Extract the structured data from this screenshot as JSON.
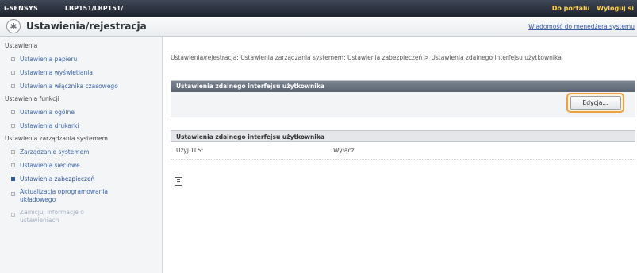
{
  "topbar": {
    "brand": "i-SENSYS",
    "model": "LBP151/LBP151/",
    "portal_link": "Do portalu",
    "logout_link": "Wyloguj si"
  },
  "header": {
    "title": "Ustawienia/rejestracja",
    "admin_message": "Wiadomość do menedżera systemu"
  },
  "sidebar": {
    "group_1": "Ustawienia",
    "paper": "Ustawienia papieru",
    "display": "Ustawienia wyświetlania",
    "timer": "Ustawienia włącznika czasowego",
    "group_2": "Ustawienia funkcji",
    "general": "Ustawienia ogólne",
    "printer": "Ustawienia drukarki",
    "group_3": "Ustawienia zarządzania systemem",
    "system_mgmt": "Zarządzanie systemem",
    "network": "Ustawienia sieciowe",
    "security": "Ustawienia zabezpieczeń",
    "firmware_line1": "Aktualizacja oprogramowania",
    "firmware_line2": "układowego",
    "clear_line1": "Zainicjuj informacje o",
    "clear_line2": "ustawieniach"
  },
  "main": {
    "breadcrumb": "Ustawienia/rejestracja: Ustawienia zarządzania systemem: Ustawienia zabezpieczeń > Ustawienia zdalnego interfejsu użytkownika",
    "panel_title": "Ustawienia zdalnego interfejsu użytkownika",
    "edit_button": "Edycja...",
    "section_title": "Ustawienia zdalnego interfejsu użytkownika",
    "tls_label": "Użyj TLS:",
    "tls_value": "Wyłącz"
  }
}
